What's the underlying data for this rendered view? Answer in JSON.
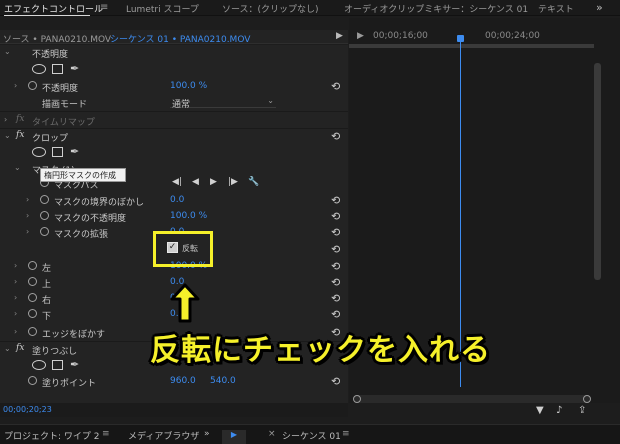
{
  "tabs": [
    {
      "label": "エフェクトコントロール",
      "active": true
    },
    {
      "label": "Lumetri スコープ"
    },
    {
      "label": "ソース：(クリップなし)"
    },
    {
      "label": "オーディオクリップミキサー：シーケンス 01"
    },
    {
      "label": "テキスト"
    }
  ],
  "tab_menu_icon": "hamburger-icon",
  "tab_more_icon": "double-chevron-right-icon",
  "source_bar": {
    "source": "ソース • PANA0210.MOV",
    "sequence": "シーケンス 01 • PANA0210.MOV"
  },
  "timeline": {
    "timecode_left": "00;00;16;00",
    "timecode_right": "00;00;24;00"
  },
  "effects": {
    "opacity_header": "不透明度",
    "opacity_label": "不透明度",
    "opacity_value": "100.0 %",
    "blend_label": "描画モード",
    "blend_value": "通常",
    "time_remap": "タイムリマップ",
    "crop": "クロップ",
    "mask_label": "マスク (1)",
    "mask_path": "マスクパス",
    "mask_feather": "マスクの境界のぼかし",
    "mask_feather_value": "0.0",
    "mask_opacity": "マスクの不透明度",
    "mask_opacity_value": "100.0 %",
    "mask_expansion": "マスクの拡張",
    "mask_expansion_value": "0.0",
    "invert_label": "反転",
    "invert_checked": true,
    "left": "左",
    "left_value": "100.0 %",
    "top": "上",
    "top_value": "0.0",
    "right": "右",
    "right_value": "0.0",
    "bottom": "下",
    "bottom_value": "0.0",
    "edge_feather": "エッジをぼかす",
    "paint": "塗りつぶし",
    "anchor_label": "塗りポイント",
    "anchor_x": "960.0",
    "anchor_y": "540.0"
  },
  "tooltip": "楕円形マスクの作成",
  "status_timecode": "00;00;20;23",
  "bottom_bar": {
    "project": "プロジェクト: ワイプ 2",
    "media_browser": "メディアブラウザ",
    "sequence_tab": "シーケンス 01"
  },
  "annotation": {
    "caption": "反転にチェックを入れる",
    "color": "#f5f02a"
  },
  "colors": {
    "accent_blue": "#3d8cf0",
    "highlight_yellow": "#f5f02a"
  }
}
